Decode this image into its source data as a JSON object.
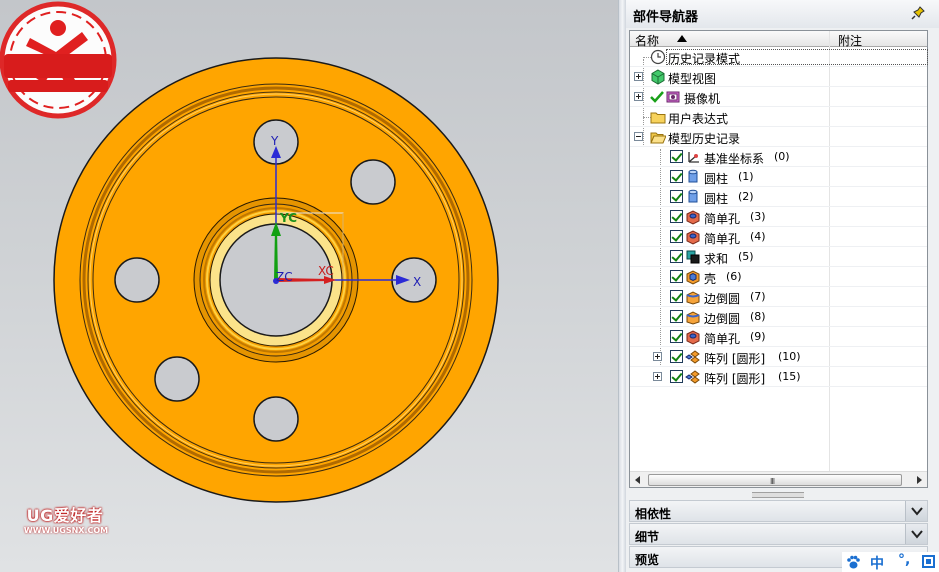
{
  "viewport": {
    "background_color": "#c9ccd0",
    "part_color": "#ffa500",
    "axes": {
      "y": "Y",
      "x": "X",
      "yc": "YC",
      "xc": "XC",
      "zc": "ZC"
    },
    "logo": {
      "text": "UG爱好者",
      "url": "WWW.UGSNX.COM",
      "color": "#e02020"
    }
  },
  "navigator": {
    "title": "部件导航器",
    "columns": {
      "name": "名称",
      "note": "附注"
    },
    "rows": [
      {
        "label": "历史记录模式",
        "icon": "clock-icon"
      },
      {
        "label": "模型视图",
        "icon": "model-view-icon"
      },
      {
        "label": "摄像机",
        "icon": "camera-icon"
      },
      {
        "label": "用户表达式",
        "icon": "folder-icon"
      },
      {
        "label": "模型历史记录",
        "icon": "folder-open-icon"
      },
      {
        "label": "基准坐标系",
        "num": "(0)",
        "icon": "datum-csys-icon"
      },
      {
        "label": "圆柱",
        "num": "(1)",
        "icon": "cylinder-icon"
      },
      {
        "label": "圆柱",
        "num": "(2)",
        "icon": "cylinder-icon"
      },
      {
        "label": "简单孔",
        "num": "(3)",
        "icon": "hole-icon"
      },
      {
        "label": "简单孔",
        "num": "(4)",
        "icon": "hole-icon"
      },
      {
        "label": "求和",
        "num": "(5)",
        "icon": "unite-icon"
      },
      {
        "label": "壳",
        "num": "(6)",
        "icon": "shell-icon"
      },
      {
        "label": "边倒圆",
        "num": "(7)",
        "icon": "edge-blend-icon"
      },
      {
        "label": "边倒圆",
        "num": "(8)",
        "icon": "edge-blend-icon"
      },
      {
        "label": "简单孔",
        "num": "(9)",
        "icon": "hole-icon"
      },
      {
        "label": "阵列 [圆形]",
        "num": "(10)",
        "icon": "pattern-icon"
      },
      {
        "label": "阵列 [圆形]",
        "num": "(15)",
        "icon": "pattern-icon"
      }
    ],
    "scroll_grip": "III",
    "sections": {
      "dependencies": "相依性",
      "details": "细节",
      "preview": "预览"
    }
  },
  "ime": {
    "lang": "中",
    "punct": "°,"
  }
}
